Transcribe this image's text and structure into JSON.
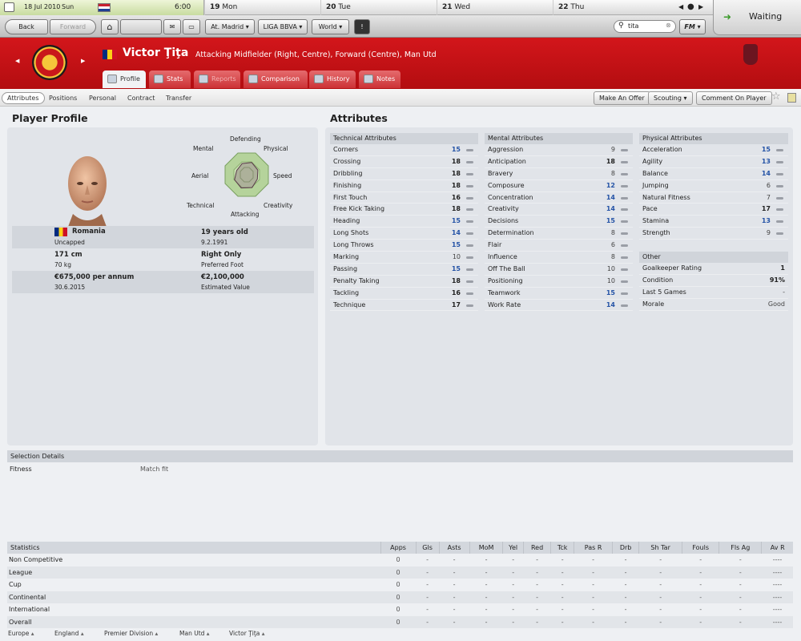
{
  "calendar": {
    "today": {
      "date": "18 Jul 2010",
      "weekday": "Sun",
      "time": "6:00"
    },
    "days": [
      {
        "num": "19",
        "name": "Mon"
      },
      {
        "num": "20",
        "name": "Tue"
      },
      {
        "num": "21",
        "name": "Wed"
      },
      {
        "num": "22",
        "name": "Thu"
      }
    ]
  },
  "nav": {
    "back": "Back",
    "forward": "Forward",
    "club_dropdown": "At. Madrid",
    "league_dropdown": "LIGA BBVA",
    "world_dropdown": "World",
    "search_value": "tita",
    "fm_label": "FM",
    "status": "Waiting"
  },
  "player": {
    "name": "Victor Ţiţa",
    "description": "Attacking Midfielder (Right, Centre), Forward (Centre), Man Utd"
  },
  "player_tabs": [
    "Profile",
    "Stats",
    "Reports",
    "Comparison",
    "History",
    "Notes"
  ],
  "sub_tabs": [
    "Attributes",
    "Positions",
    "Personal",
    "Contract",
    "Transfer"
  ],
  "actions": {
    "offer": "Make An Offer",
    "scouting": "Scouting",
    "comment": "Comment On Player"
  },
  "profile": {
    "title": "Player Profile",
    "radar_labels": {
      "defending": "Defending",
      "physical": "Physical",
      "speed": "Speed",
      "creativity": "Creativity",
      "attacking": "Attacking",
      "technical": "Technical",
      "aerial": "Aerial",
      "mental": "Mental"
    },
    "radar_values": [
      0.55,
      0.5,
      0.48,
      0.58,
      0.6,
      0.55,
      0.45,
      0.5
    ],
    "nation": "Romania",
    "nation_sub": "Uncapped",
    "age": "19 years old",
    "dob": "9.2.1991",
    "height": "171 cm",
    "weight": "70 kg",
    "foot": "Right Only",
    "foot_sub": "Preferred Foot",
    "wage": "€675,000 per annum",
    "contract_end": "30.6.2015",
    "value": "€2,100,000",
    "value_sub": "Estimated Value"
  },
  "attributes": {
    "title": "Attributes",
    "technical": {
      "header": "Technical Attributes",
      "rows": [
        {
          "label": "Corners",
          "value": "15",
          "style": "blue"
        },
        {
          "label": "Crossing",
          "value": "18",
          "style": "bold"
        },
        {
          "label": "Dribbling",
          "value": "18",
          "style": "bold"
        },
        {
          "label": "Finishing",
          "value": "18",
          "style": "bold"
        },
        {
          "label": "First Touch",
          "value": "16",
          "style": "bold"
        },
        {
          "label": "Free Kick Taking",
          "value": "18",
          "style": "bold"
        },
        {
          "label": "Heading",
          "value": "15",
          "style": "blue"
        },
        {
          "label": "Long Shots",
          "value": "14",
          "style": "blue"
        },
        {
          "label": "Long Throws",
          "value": "15",
          "style": "blue"
        },
        {
          "label": "Marking",
          "value": "10",
          "style": "plain"
        },
        {
          "label": "Passing",
          "value": "15",
          "style": "blue"
        },
        {
          "label": "Penalty Taking",
          "value": "18",
          "style": "bold"
        },
        {
          "label": "Tackling",
          "value": "16",
          "style": "bold"
        },
        {
          "label": "Technique",
          "value": "17",
          "style": "bold"
        }
      ]
    },
    "mental": {
      "header": "Mental Attributes",
      "rows": [
        {
          "label": "Aggression",
          "value": "9",
          "style": "plain"
        },
        {
          "label": "Anticipation",
          "value": "18",
          "style": "bold"
        },
        {
          "label": "Bravery",
          "value": "8",
          "style": "plain"
        },
        {
          "label": "Composure",
          "value": "12",
          "style": "blue"
        },
        {
          "label": "Concentration",
          "value": "14",
          "style": "blue"
        },
        {
          "label": "Creativity",
          "value": "14",
          "style": "blue"
        },
        {
          "label": "Decisions",
          "value": "15",
          "style": "blue"
        },
        {
          "label": "Determination",
          "value": "8",
          "style": "plain"
        },
        {
          "label": "Flair",
          "value": "6",
          "style": "plain"
        },
        {
          "label": "Influence",
          "value": "8",
          "style": "plain"
        },
        {
          "label": "Off The Ball",
          "value": "10",
          "style": "plain"
        },
        {
          "label": "Positioning",
          "value": "10",
          "style": "plain"
        },
        {
          "label": "Teamwork",
          "value": "15",
          "style": "blue"
        },
        {
          "label": "Work Rate",
          "value": "14",
          "style": "blue"
        }
      ]
    },
    "physical": {
      "header": "Physical Attributes",
      "rows": [
        {
          "label": "Acceleration",
          "value": "15",
          "style": "blue"
        },
        {
          "label": "Agility",
          "value": "13",
          "style": "blue"
        },
        {
          "label": "Balance",
          "value": "14",
          "style": "blue"
        },
        {
          "label": "Jumping",
          "value": "6",
          "style": "plain"
        },
        {
          "label": "Natural Fitness",
          "value": "7",
          "style": "plain"
        },
        {
          "label": "Pace",
          "value": "17",
          "style": "bold"
        },
        {
          "label": "Stamina",
          "value": "13",
          "style": "blue"
        },
        {
          "label": "Strength",
          "value": "9",
          "style": "plain"
        }
      ]
    },
    "other": {
      "header": "Other",
      "rows": [
        {
          "label": "Goalkeeper Rating",
          "value": "1"
        },
        {
          "label": "Condition",
          "value": "91%"
        },
        {
          "label": "Last 5 Games",
          "value": "-"
        },
        {
          "label": "Morale",
          "value": "Good"
        }
      ]
    }
  },
  "selection": {
    "header": "Selection Details",
    "fitness_label": "Fitness",
    "fitness_value": "Match fit"
  },
  "statistics": {
    "columns": [
      "Statistics",
      "Apps",
      "Gls",
      "Asts",
      "MoM",
      "Yel",
      "Red",
      "Tck",
      "Pas R",
      "Drb",
      "Sh Tar",
      "Fouls",
      "Fls Ag",
      "Av R"
    ],
    "rows": [
      [
        "Non Competitive",
        "0",
        "-",
        "-",
        "-",
        "-",
        "-",
        "-",
        "-",
        "-",
        "-",
        "-",
        "-",
        "----"
      ],
      [
        "League",
        "0",
        "-",
        "-",
        "-",
        "-",
        "-",
        "-",
        "-",
        "-",
        "-",
        "-",
        "-",
        "----"
      ],
      [
        "Cup",
        "0",
        "-",
        "-",
        "-",
        "-",
        "-",
        "-",
        "-",
        "-",
        "-",
        "-",
        "-",
        "----"
      ],
      [
        "Continental",
        "0",
        "-",
        "-",
        "-",
        "-",
        "-",
        "-",
        "-",
        "-",
        "-",
        "-",
        "-",
        "----"
      ],
      [
        "International",
        "0",
        "-",
        "-",
        "-",
        "-",
        "-",
        "-",
        "-",
        "-",
        "-",
        "-",
        "-",
        "----"
      ],
      [
        "Overall",
        "0",
        "-",
        "-",
        "-",
        "-",
        "-",
        "-",
        "-",
        "-",
        "-",
        "-",
        "-",
        "----"
      ]
    ]
  },
  "breadcrumbs": [
    "Europe",
    "England",
    "Premier Division",
    "Man Utd",
    "Victor Ţiţa"
  ],
  "colors": {
    "accent_red": "#c4151a",
    "value_blue": "#2453a6"
  }
}
